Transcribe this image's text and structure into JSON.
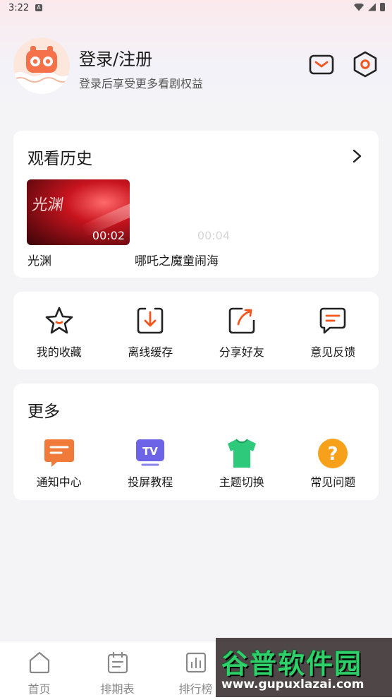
{
  "status_bar": {
    "time": "3:22",
    "badge": "A"
  },
  "profile": {
    "title": "登录/注册",
    "subtitle": "登录后享受更多看剧权益",
    "icons": [
      "mail-icon",
      "settings-icon"
    ]
  },
  "history": {
    "title": "观看历史",
    "items": [
      {
        "title": "光渊",
        "time": "00:02",
        "thumb_text": "光渊"
      },
      {
        "title": "哪吒之魔童闹海",
        "time": "00:04"
      }
    ]
  },
  "actions": [
    {
      "label": "我的收藏",
      "icon": "star-icon"
    },
    {
      "label": "离线缓存",
      "icon": "download-icon"
    },
    {
      "label": "分享好友",
      "icon": "share-icon"
    },
    {
      "label": "意见反馈",
      "icon": "feedback-icon"
    }
  ],
  "more": {
    "title": "更多",
    "items": [
      {
        "label": "通知中心",
        "icon": "notification-icon"
      },
      {
        "label": "投屏教程",
        "icon": "tv-icon"
      },
      {
        "label": "主题切换",
        "icon": "theme-shirt-icon"
      },
      {
        "label": "常见问题",
        "icon": "faq-icon"
      }
    ]
  },
  "nav": [
    {
      "label": "首页",
      "icon": "home-icon"
    },
    {
      "label": "排期表",
      "icon": "calendar-icon"
    },
    {
      "label": "排行榜",
      "icon": "chart-icon"
    },
    {
      "label": "",
      "icon": ""
    },
    {
      "label": "",
      "icon": ""
    }
  ],
  "watermark": {
    "text": "谷普软件园",
    "url": "www.gupuxlazai.com"
  },
  "colors": {
    "accent": "#f0561d",
    "green": "#2fd06a",
    "purple": "#6d63e6"
  }
}
